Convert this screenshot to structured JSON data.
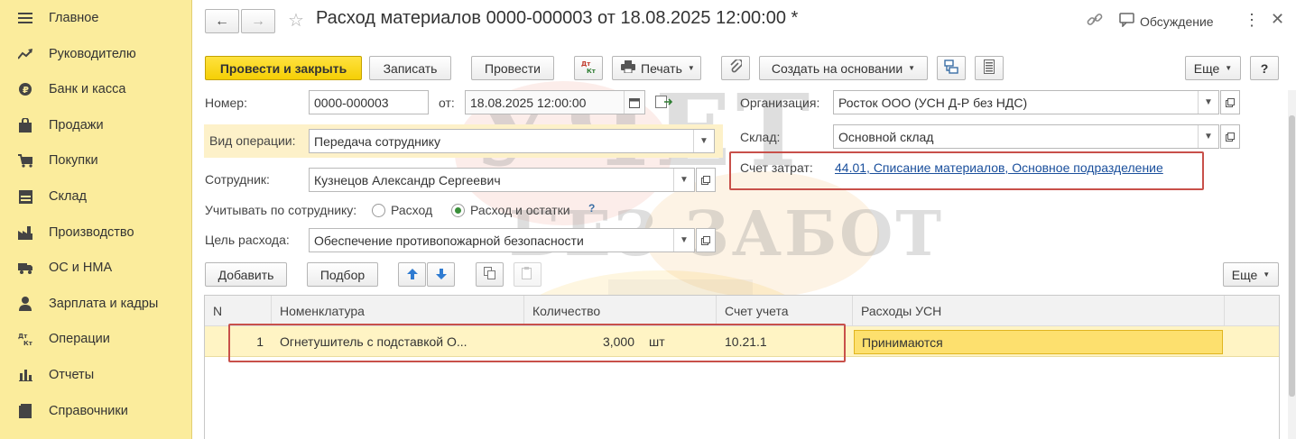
{
  "sidebar": {
    "items": [
      {
        "label": "Главное",
        "icon": "menu-icon"
      },
      {
        "label": "Руководителю",
        "icon": "trend-icon"
      },
      {
        "label": "Банк и касса",
        "icon": "coin-icon"
      },
      {
        "label": "Продажи",
        "icon": "bag-icon"
      },
      {
        "label": "Покупки",
        "icon": "cart-icon"
      },
      {
        "label": "Склад",
        "icon": "warehouse-icon"
      },
      {
        "label": "Производство",
        "icon": "factory-icon"
      },
      {
        "label": "ОС и НМА",
        "icon": "truck-icon"
      },
      {
        "label": "Зарплата и кадры",
        "icon": "person-icon"
      },
      {
        "label": "Операции",
        "icon": "dt-kt-icon"
      },
      {
        "label": "Отчеты",
        "icon": "bar-chart-icon"
      },
      {
        "label": "Справочники",
        "icon": "book-icon"
      }
    ]
  },
  "header": {
    "title": "Расход материалов 0000-000003 от 18.08.2025 12:00:00 *",
    "discussion": "Обсуждение"
  },
  "toolbar": {
    "post_close": "Провести и закрыть",
    "save": "Записать",
    "post": "Провести",
    "print": "Печать",
    "create_based": "Создать на основании",
    "more": "Еще",
    "help": "?"
  },
  "form": {
    "number_label": "Номер:",
    "number_value": "0000-000003",
    "from_label": "от:",
    "date_value": "18.08.2025 12:00:00",
    "operation_label": "Вид операции:",
    "operation_value": "Передача сотруднику",
    "employee_label": "Сотрудник:",
    "employee_value": "Кузнецов Александр Сергеевич",
    "account_by_label": "Учитывать по сотруднику:",
    "radio_expense": "Расход",
    "radio_expense_balance": "Расход и остатки",
    "purpose_label": "Цель расхода:",
    "purpose_value": "Обеспечение противопожарной безопасности",
    "org_label": "Организация:",
    "org_value": "Росток ООО (УСН Д-Р без НДС)",
    "warehouse_label": "Склад:",
    "warehouse_value": "Основной склад",
    "cost_account_label": "Счет затрат:",
    "cost_account_value": "44.01, Списание материалов, Основное подразделение"
  },
  "table_toolbar": {
    "add": "Добавить",
    "select": "Подбор",
    "more": "Еще"
  },
  "table": {
    "columns": [
      "N",
      "Номенклатура",
      "Количество",
      "Счет учета",
      "Расходы УСН"
    ],
    "rows": [
      {
        "n": "1",
        "item": "Огнетушитель с подставкой О...",
        "qty": "3,000",
        "unit": "шт",
        "account": "10.21.1",
        "usn": "Принимаются"
      }
    ]
  },
  "watermark": {
    "line1": "УЧЕТ",
    "line2": "БЕЗ ЗАБОТ"
  },
  "colors": {
    "sidebar": "#fbec9c",
    "accent_button": "#f7d41a",
    "selected_row": "#fff4c4",
    "highlight_box": "#c8504a",
    "link": "#1a4f9c"
  }
}
